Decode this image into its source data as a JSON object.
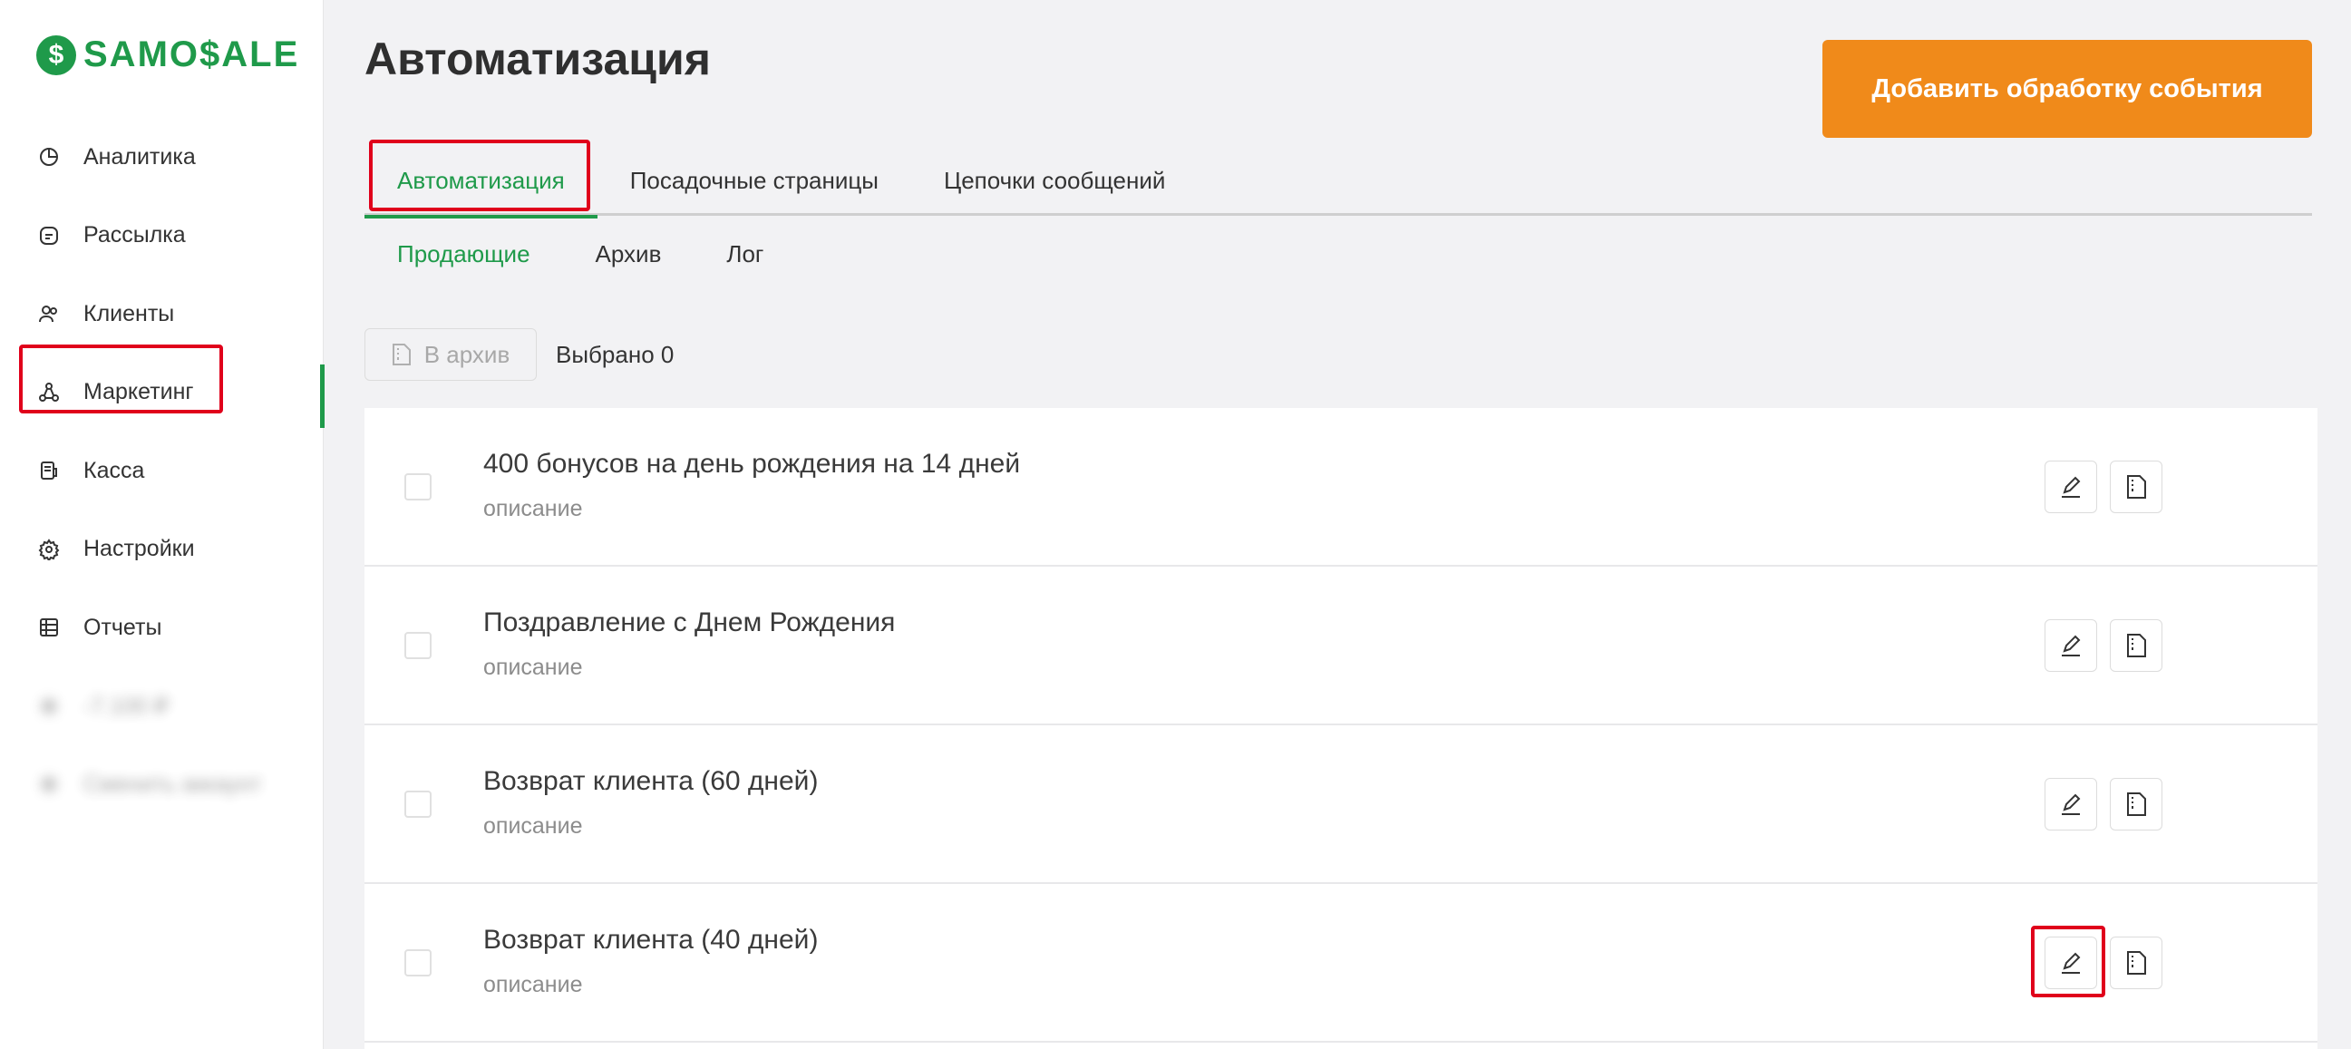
{
  "logo": {
    "mark": "$",
    "text": "SAMO$ALE"
  },
  "sidebar": {
    "items": [
      {
        "label": "Аналитика",
        "icon": "pie-chart-icon"
      },
      {
        "label": "Рассылка",
        "icon": "message-icon"
      },
      {
        "label": "Клиенты",
        "icon": "users-icon"
      },
      {
        "label": "Маркетинг",
        "icon": "marketing-nodes-icon",
        "active": true
      },
      {
        "label": "Касса",
        "icon": "register-icon"
      },
      {
        "label": "Настройки",
        "icon": "gear-icon"
      },
      {
        "label": "Отчеты",
        "icon": "table-icon"
      },
      {
        "label": "-7.100 ₽",
        "icon": "balance-icon",
        "blurred": true
      },
      {
        "label": "Сменить аккаунт",
        "icon": "account-switch-icon",
        "blurred": true
      }
    ]
  },
  "header": {
    "title": "Автоматизация",
    "add_button": "Добавить обработку события"
  },
  "tabs": [
    "Автоматизация",
    "Посадочные страницы",
    "Цепочки сообщений"
  ],
  "subtabs": [
    "Продающие",
    "Архив",
    "Лог"
  ],
  "toolbar": {
    "archive_button": "В архив",
    "selected": "Выбрано 0"
  },
  "rows": [
    {
      "title": "400 бонусов на день рождения на 14 дней",
      "desc": "описание"
    },
    {
      "title": "Поздравление с Днем Рождения",
      "desc": "описание"
    },
    {
      "title": "Возврат клиента (60 дней)",
      "desc": "описание"
    },
    {
      "title": "Возврат клиента (40 дней)",
      "desc": "описание"
    }
  ],
  "colors": {
    "accent": "#1f9a4a",
    "button": "#f08a1a",
    "highlight": "#e0001b"
  }
}
